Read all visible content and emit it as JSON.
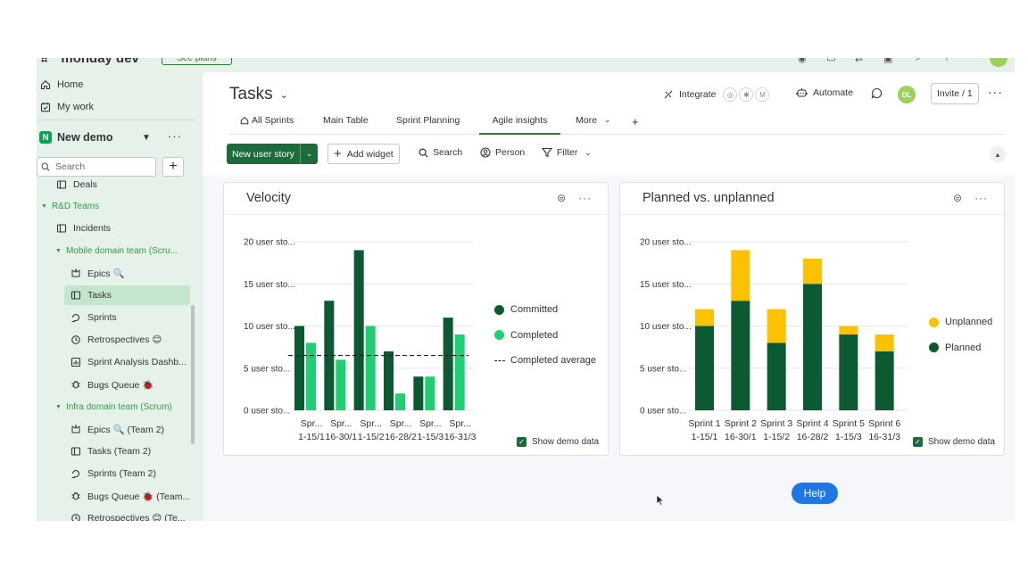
{
  "topbar": {
    "logo_text": "monday dev",
    "plans_label": "See plans"
  },
  "sidebar": {
    "home": "Home",
    "my_work": "My work",
    "workspace": {
      "badge": "N",
      "name": "New demo"
    },
    "search_placeholder": "Search",
    "items": [
      {
        "label": "Deals",
        "icon": "board-icon",
        "kind": "item"
      },
      {
        "label": "R&D Teams",
        "kind": "folder"
      },
      {
        "label": "Incidents",
        "icon": "board-icon",
        "kind": "item"
      },
      {
        "label": "Mobile domain team (Scru...",
        "kind": "folder"
      },
      {
        "label": "Epics 🔍",
        "icon": "epics-icon",
        "kind": "item"
      },
      {
        "label": "Tasks",
        "icon": "board-icon",
        "kind": "item",
        "active": true
      },
      {
        "label": "Sprints",
        "icon": "sprint-icon",
        "kind": "item"
      },
      {
        "label": "Retrospectives 😊",
        "icon": "retro-icon",
        "kind": "item"
      },
      {
        "label": "Sprint Analysis Dashb...",
        "icon": "dashboard-icon",
        "kind": "item"
      },
      {
        "label": "Bugs Queue 🐞",
        "icon": "bug-icon",
        "kind": "item"
      },
      {
        "label": "Infra domain team (Scrum)",
        "kind": "folder"
      },
      {
        "label": "Epics 🔍 (Team 2)",
        "icon": "epics-icon",
        "kind": "item"
      },
      {
        "label": "Tasks (Team 2)",
        "icon": "board-icon",
        "kind": "item"
      },
      {
        "label": "Sprints (Team 2)",
        "icon": "sprint-icon",
        "kind": "item"
      },
      {
        "label": "Bugs Queue 🐞 (Team...",
        "icon": "bug-icon",
        "kind": "item"
      },
      {
        "label": "Retrospectives 😊 (Te...",
        "icon": "retro-icon",
        "kind": "item"
      }
    ]
  },
  "board": {
    "title": "Tasks",
    "integrate": "Integrate",
    "automate": "Automate",
    "avatar": "DL",
    "invite": "Invite / 1",
    "tabs": [
      "All Sprints",
      "Main Table",
      "Sprint Planning",
      "Agile insights",
      "More"
    ],
    "active_tab": "Agile insights",
    "toolbar": {
      "new_item": "New user story",
      "add_widget": "Add widget",
      "search": "Search",
      "person": "Person",
      "filter": "Filter"
    }
  },
  "colors": {
    "committed": "#0b5a32",
    "completed": "#1fcf74",
    "planned": "#0b5a32",
    "unplanned": "#fcc200"
  },
  "show_demo_data": "Show demo data",
  "help": "Help",
  "chart_data": [
    {
      "type": "bar",
      "title": "Velocity",
      "ytick_labels": [
        "20 user sto...",
        "15 user sto...",
        "10 user sto...",
        "5 user sto...",
        "0 user sto..."
      ],
      "ylim": [
        0,
        20
      ],
      "categories": [
        "Spr...",
        "Spr...",
        "Spr...",
        "Spr...",
        "Spr...",
        "Spr..."
      ],
      "category_dates": [
        "1-15/1",
        "16-30/1",
        "1-15/2",
        "16-28/2",
        "1-15/3",
        "16-31/3"
      ],
      "series": [
        {
          "name": "Committed",
          "values": [
            10,
            13,
            19,
            7,
            4,
            11
          ]
        },
        {
          "name": "Completed",
          "values": [
            8,
            6,
            10,
            2,
            4,
            9
          ]
        }
      ],
      "average_line": {
        "name": "Completed average",
        "value": 6.5
      },
      "legend": "right"
    },
    {
      "type": "bar",
      "stacked": true,
      "title": "Planned vs. unplanned",
      "ytick_labels": [
        "20 user sto...",
        "15 user sto...",
        "10 user sto...",
        "5 user sto...",
        "0 user sto..."
      ],
      "ylim": [
        0,
        20
      ],
      "categories": [
        "Sprint 1",
        "Sprint 2",
        "Sprint 3",
        "Sprint 4",
        "Sprint 5",
        "Sprint 6"
      ],
      "category_dates": [
        "1-15/1",
        "16-30/1",
        "1-15/2",
        "16-28/2",
        "1-15/3",
        "16-31/3"
      ],
      "series": [
        {
          "name": "Planned",
          "values": [
            10,
            13,
            8,
            15,
            9,
            7
          ]
        },
        {
          "name": "Unplanned",
          "values": [
            2,
            6,
            4,
            3,
            1,
            2
          ]
        }
      ],
      "legend_order": [
        "Unplanned",
        "Planned"
      ],
      "legend": "right"
    }
  ]
}
